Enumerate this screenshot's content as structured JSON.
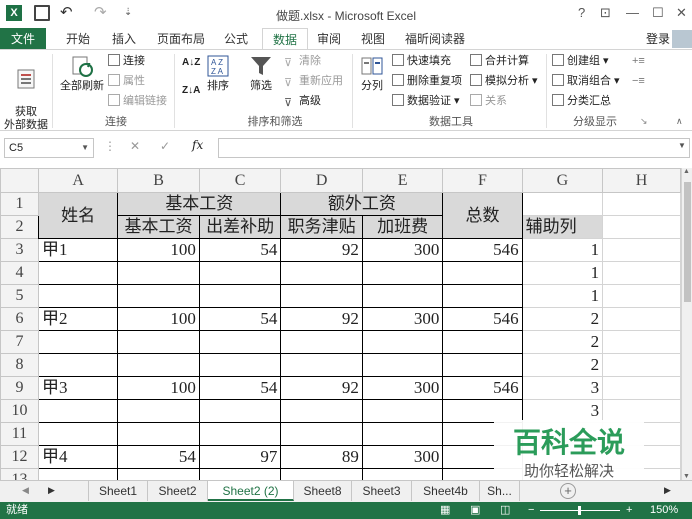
{
  "window": {
    "title": "做题.xlsx - Microsoft Excel",
    "help": "?",
    "restore": "⊡",
    "minimize": "—",
    "maximize": "☐",
    "close": "✕",
    "login": "登录"
  },
  "quick_access": {
    "excel_logo": "X",
    "undo": "↶",
    "redo": "↷",
    "more": "⇣"
  },
  "ribbon_tabs": [
    "文件",
    "开始",
    "插入",
    "页面布局",
    "公式",
    "数据",
    "审阅",
    "视图",
    "福昕阅读器"
  ],
  "active_tab": "数据",
  "ribbon": {
    "get_external": "获取\n外部数据",
    "refresh_all": "全部刷新",
    "connections": "连接",
    "properties": "属性",
    "edit_links": "编辑链接",
    "group_connections": "连接",
    "sort": "排序",
    "filter": "筛选",
    "clear": "清除",
    "reapply": "重新应用",
    "advanced": "高级",
    "group_sort": "排序和筛选",
    "text_to_columns": "分列",
    "flash_fill": "快速填充",
    "remove_duplicates": "删除重复项",
    "data_validation": "数据验证",
    "consolidate": "合并计算",
    "what_if": "模拟分析",
    "relationships": "关系",
    "group_tools": "数据工具",
    "group_outline_create": "创建组",
    "ungroup": "取消组合",
    "subtotal": "分类汇总",
    "group_outline": "分级显示"
  },
  "formula_bar": {
    "name_box": "C5",
    "cancel": "✕",
    "enter": "✓",
    "fx": "fx",
    "formula": ""
  },
  "columns": [
    "A",
    "B",
    "C",
    "D",
    "E",
    "F",
    "G",
    "H"
  ],
  "rows": [
    "1",
    "2",
    "3",
    "4",
    "5",
    "6",
    "7",
    "8",
    "9",
    "10",
    "11",
    "12",
    "13"
  ],
  "headers": {
    "name": "姓名",
    "basic_group": "基本工资",
    "extra_group": "额外工资",
    "total": "总数",
    "basic": "基本工资",
    "travel": "出差补助",
    "duty": "职务津贴",
    "overtime": "加班费",
    "helper": "辅助列"
  },
  "data_rows": [
    {
      "name": "甲1",
      "basic": "100",
      "travel": "54",
      "duty": "92",
      "overtime": "300",
      "total": "546",
      "helper": "1"
    },
    {
      "name": "",
      "basic": "",
      "travel": "",
      "duty": "",
      "overtime": "",
      "total": "",
      "helper": "1"
    },
    {
      "name": "",
      "basic": "",
      "travel": "",
      "duty": "",
      "overtime": "",
      "total": "",
      "helper": "1"
    },
    {
      "name": "甲2",
      "basic": "100",
      "travel": "54",
      "duty": "92",
      "overtime": "300",
      "total": "546",
      "helper": "2"
    },
    {
      "name": "",
      "basic": "",
      "travel": "",
      "duty": "",
      "overtime": "",
      "total": "",
      "helper": "2"
    },
    {
      "name": "",
      "basic": "",
      "travel": "",
      "duty": "",
      "overtime": "",
      "total": "",
      "helper": "2"
    },
    {
      "name": "甲3",
      "basic": "100",
      "travel": "54",
      "duty": "92",
      "overtime": "300",
      "total": "546",
      "helper": "3"
    },
    {
      "name": "",
      "basic": "",
      "travel": "",
      "duty": "",
      "overtime": "",
      "total": "",
      "helper": "3"
    },
    {
      "name": "",
      "basic": "",
      "travel": "",
      "duty": "",
      "overtime": "",
      "total": "",
      "helper": ""
    },
    {
      "name": "甲4",
      "basic": "54",
      "travel": "97",
      "duty": "89",
      "overtime": "300",
      "total": "",
      "helper": ""
    },
    {
      "name": "",
      "basic": "",
      "travel": "",
      "duty": "",
      "overtime": "",
      "total": "",
      "helper": ""
    }
  ],
  "sheet_tabs": [
    "Sheet1",
    "Sheet2",
    "Sheet2 (2)",
    "Sheet8",
    "Sheet3",
    "Sheet4b",
    "Sh..."
  ],
  "active_sheet": "Sheet2 (2)",
  "status": {
    "ready": "就绪",
    "zoom": "150%"
  },
  "watermark": {
    "title": "百科全说",
    "subtitle": "助你轻松解决"
  },
  "colors": {
    "excel_green": "#217346",
    "header_fill": "#d9d9d9",
    "watermark_green": "#2b9c5a"
  }
}
